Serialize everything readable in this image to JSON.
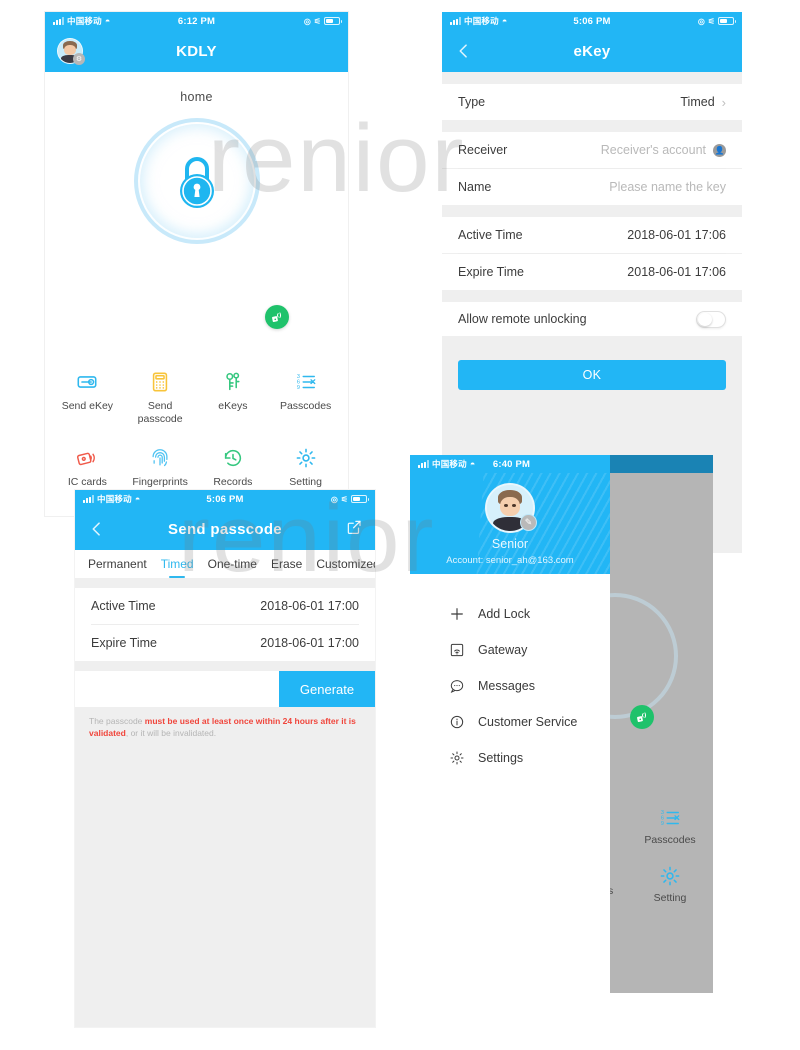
{
  "watermark": {
    "text_1": "renior",
    "text_2": "renior"
  },
  "colors": {
    "brand_blue": "#22b6f5",
    "accent_green": "#1fc26b",
    "warning_red": "#f0463c",
    "page_gray": "#efefef",
    "dim_gray": "#b5b5b5"
  },
  "phone1": {
    "status": {
      "carrier": "中国移动",
      "time": "6:12 PM",
      "wifi_icon": "wifi-icon",
      "location_icon": "location-icon",
      "bluetooth_icon": "bluetooth-icon",
      "battery_icon": "battery-icon"
    },
    "nav": {
      "title": "KDLY",
      "avatar_icon": "avatar-icon"
    },
    "home_label": "home",
    "lock_icon": "padlock-icon",
    "wifi_fab_icon": "gateway-signal-icon",
    "tiles": [
      {
        "label": "Send eKey",
        "icon": "send-ekey-icon",
        "color": "#2fb8ee"
      },
      {
        "label": "Send\npasscode",
        "icon": "send-passcode-icon",
        "color": "#f8c43a"
      },
      {
        "label": "eKeys",
        "icon": "ekeys-icon",
        "color": "#35c77f"
      },
      {
        "label": "Passcodes",
        "icon": "passcodes-icon",
        "color": "#2fb8ee"
      },
      {
        "label": "IC cards",
        "icon": "ic-cards-icon",
        "color": "#f05a4a"
      },
      {
        "label": "Fingerprints",
        "icon": "fingerprint-icon",
        "color": "#4fc3f2"
      },
      {
        "label": "Records",
        "icon": "records-icon",
        "color": "#35c77f"
      },
      {
        "label": "Setting",
        "icon": "gear-icon",
        "color": "#2fb8ee"
      }
    ]
  },
  "phone2": {
    "status": {
      "carrier": "中国移动",
      "time": "5:06 PM"
    },
    "nav": {
      "title": "eKey",
      "back_icon": "back-arrow-icon"
    },
    "rows": [
      {
        "label": "Type",
        "value": "Timed",
        "placeholder": false,
        "chevron": true
      },
      {
        "label": "Receiver",
        "value": "Receiver's account",
        "placeholder": true,
        "account_icon": "account-icon"
      },
      {
        "label": "Name",
        "value": "Please name the key",
        "placeholder": true
      },
      {
        "label": "Active Time",
        "value": "2018-06-01 17:06",
        "placeholder": false
      },
      {
        "label": "Expire Time",
        "value": "2018-06-01 17:06",
        "placeholder": false
      },
      {
        "label": "Allow remote unlocking",
        "value": "",
        "toggle": "off"
      }
    ],
    "ok_button": "OK"
  },
  "phone3": {
    "status": {
      "carrier": "中国移动",
      "time": "5:06 PM"
    },
    "nav": {
      "title": "Send passcode",
      "back_icon": "back-arrow-icon",
      "share_icon": "share-icon"
    },
    "tabs": [
      {
        "label": "Permanent",
        "active": false
      },
      {
        "label": "Timed",
        "active": true
      },
      {
        "label": "One-time",
        "active": false
      },
      {
        "label": "Erase",
        "active": false
      },
      {
        "label": "Customized",
        "active": false
      }
    ],
    "rows": [
      {
        "label": "Active Time",
        "value": "2018-06-01 17:00"
      },
      {
        "label": "Expire Time",
        "value": "2018-06-01 17:00"
      }
    ],
    "generate_input_value": "",
    "generate_button": "Generate",
    "note_prefix": "The passcode ",
    "note_highlight_1": "must be used at least once within 24 hours after it is validated",
    "note_suffix": ", or it will be invalidated."
  },
  "phone4": {
    "status": {
      "carrier": "中国移动",
      "time": "6:40 PM"
    },
    "profile": {
      "name": "Senior",
      "account": "Account: senior_ah@163.com",
      "avatar_icon": "avatar-icon",
      "edit_icon": "edit-icon"
    },
    "menu": [
      {
        "label": "Add Lock",
        "icon": "plus-icon"
      },
      {
        "label": "Gateway",
        "icon": "gateway-icon"
      },
      {
        "label": "Messages",
        "icon": "message-icon"
      },
      {
        "label": "Customer Service",
        "icon": "info-icon"
      },
      {
        "label": "Settings",
        "icon": "gear-icon"
      }
    ],
    "dimmed": {
      "fab_icon": "gateway-signal-icon",
      "tiles": [
        {
          "label": "Passcodes",
          "icon": "passcodes-icon"
        },
        {
          "label": "Setting",
          "icon": "gear-icon"
        }
      ],
      "partial_label": "s"
    }
  }
}
